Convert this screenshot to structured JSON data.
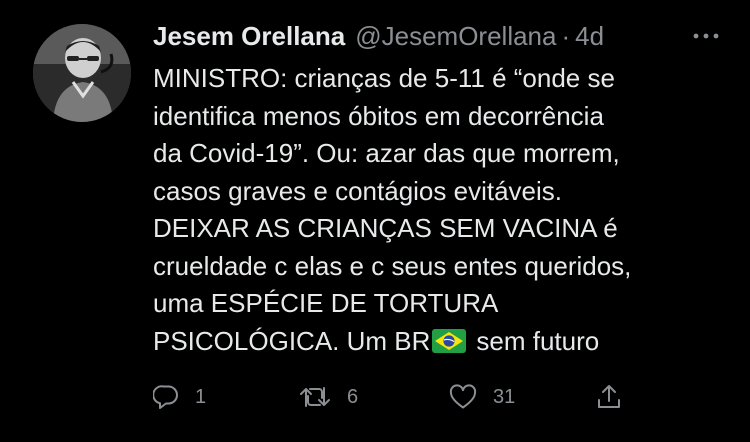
{
  "tweet": {
    "author_name": "Jesem Orellana",
    "handle": "@JesemOrellana",
    "separator": "·",
    "time": "4d",
    "text_lines": [
      "MINISTRO: crianças de 5-11 é “onde se",
      "identifica menos óbitos em decorrência",
      "da Covid-19”. Ou: azar das que morrem,",
      "casos graves e contágios evitáveis.",
      "DEIXAR AS CRIANÇAS SEM VACINA é",
      "crueldade c elas e c seus entes queridos,",
      "uma ESPÉCIE DE TORTURA",
      "PSICOLÓGICA. Um BR",
      "sem futuro"
    ],
    "flag_icon": "brazil-flag-icon",
    "actions": {
      "reply_count": "1",
      "retweet_count": "6",
      "like_count": "31"
    }
  },
  "colors": {
    "background": "#000000",
    "text_primary": "#e7e9ea",
    "text_secondary": "#8b8f94"
  }
}
